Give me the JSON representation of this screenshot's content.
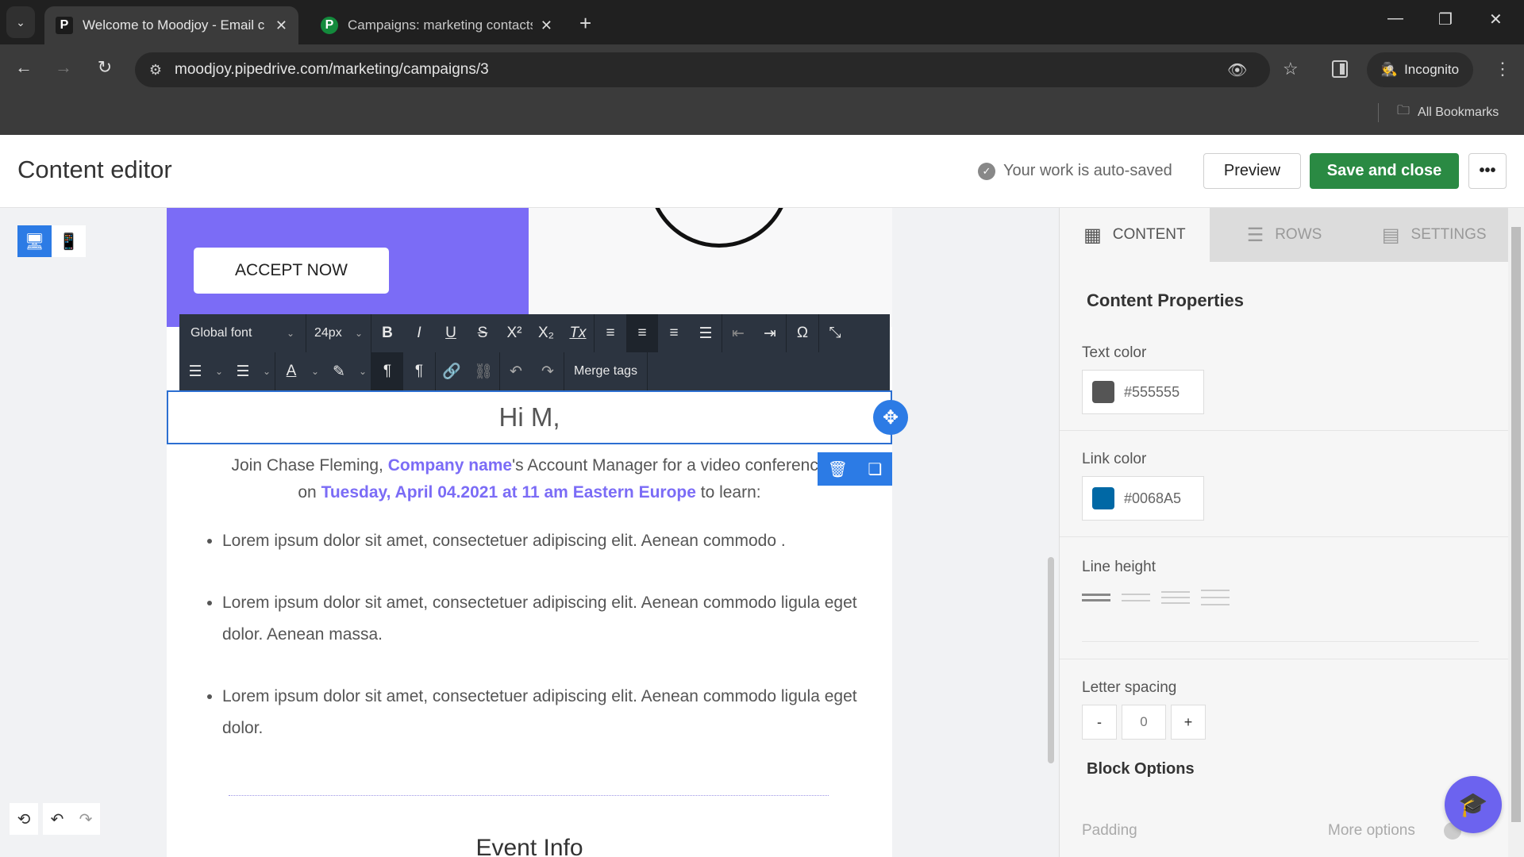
{
  "browser": {
    "tabs": [
      {
        "title": "Welcome to Moodjoy - Email c",
        "favicon": "P",
        "active": true
      },
      {
        "title": "Campaigns: marketing contacts",
        "favicon": "P",
        "active": false
      }
    ],
    "new_tab": "+",
    "url": "moodjoy.pipedrive.com/marketing/campaigns/3",
    "profile_label": "Incognito",
    "bookmarks_label": "All Bookmarks",
    "icons": {
      "back": "←",
      "forward": "→",
      "reload": "↻",
      "site_info": "⚙",
      "eye_off": "👁",
      "star": "☆",
      "menu": "⋮",
      "folder": "🗀",
      "minimize": "—",
      "restore": "❐",
      "close": "✕",
      "tab_close": "✕",
      "tab_dropdown": "⌄"
    }
  },
  "header": {
    "title": "Content editor",
    "autosave_text": "Your work is auto-saved",
    "preview_label": "Preview",
    "save_label": "Save and close",
    "more_label": "•••"
  },
  "canvas": {
    "device_desktop": "🖥",
    "device_mobile": "📱",
    "history_icon": "⟲",
    "undo_icon": "↶",
    "redo_icon": "↷"
  },
  "email": {
    "accept_button": "ACCEPT NOW",
    "greeting": "Hi M,",
    "intro_line1_a": "Join Chase Fleming, ",
    "intro_company": "Company name",
    "intro_line1_b": "'s Account Manager for a video conference",
    "intro_line2_a": "on ",
    "intro_date": "Tuesday, April 04.2021 at 11 am Eastern Europe",
    "intro_line2_b": " to learn:",
    "bullets": [
      "Lorem ipsum dolor sit amet, consectetuer adipiscing elit. Aenean commodo .",
      "Lorem ipsum dolor sit amet, consectetuer adipiscing elit. Aenean commodo ligula eget dolor. Aenean massa.",
      "Lorem ipsum dolor sit amet, consectetuer adipiscing elit. Aenean commodo ligula eget dolor."
    ],
    "event_title": "Event Info",
    "colors": {
      "hero": "#7b6cf6",
      "accent_link": "#7b6cf6"
    }
  },
  "rte_toolbar": {
    "font_family": "Global font",
    "font_size": "24px",
    "row1_buttons": [
      "B",
      "I",
      "U",
      "S",
      "X²",
      "X₂",
      "Tx"
    ],
    "align_buttons": [
      "≡L",
      "≡C",
      "≡R",
      "≡J"
    ],
    "indent_buttons": [
      "⇤",
      "⇥"
    ],
    "special_char": "Ω",
    "collapse": "⤡",
    "list_ordered": "☰",
    "list_bullet": "☰",
    "text_color": "A",
    "highlight": "✎",
    "ltr": "¶",
    "rtl": "¶",
    "link": "🔗",
    "unlink": "⛓",
    "undo": "↶",
    "redo": "↷",
    "merge_tags": "Merge tags"
  },
  "block_controls": {
    "move_icon": "✥",
    "delete_icon": "🗑",
    "duplicate_icon": "❏"
  },
  "panel": {
    "tabs": [
      {
        "label": "CONTENT",
        "icon": "▦",
        "active": true
      },
      {
        "label": "ROWS",
        "icon": "☰",
        "active": false
      },
      {
        "label": "SETTINGS",
        "icon": "▤",
        "active": false
      }
    ],
    "section_title": "Content Properties",
    "text_color_label": "Text color",
    "text_color_value": "#555555",
    "link_color_label": "Link color",
    "link_color_value": "#0068A5",
    "line_height_label": "Line height",
    "line_height_selected": 1,
    "letter_spacing_label": "Letter spacing",
    "letter_spacing_minus": "-",
    "letter_spacing_value": "0",
    "letter_spacing_plus": "+",
    "block_options_title": "Block Options",
    "padding_label": "Padding",
    "more_options_label": "More options",
    "more_options_enabled": false,
    "help_icon": "🎓"
  }
}
